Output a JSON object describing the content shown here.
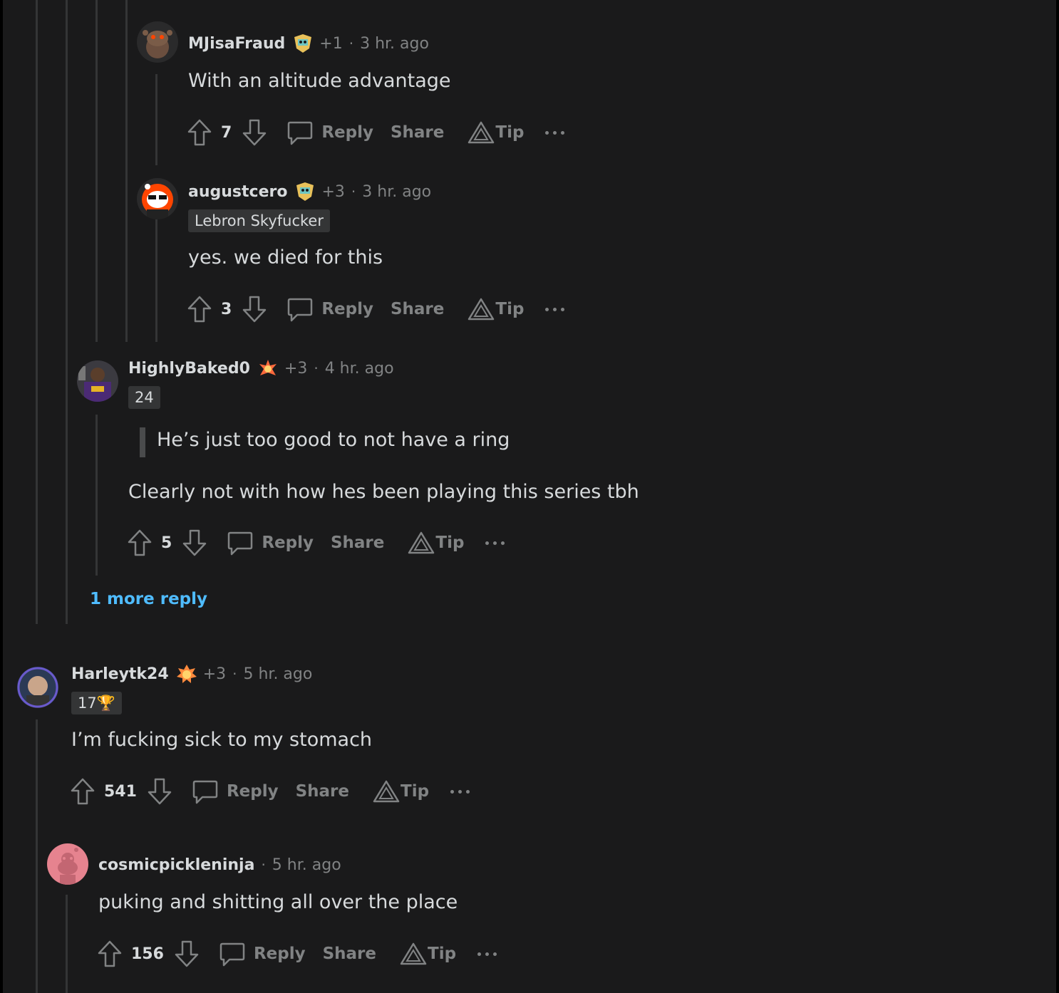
{
  "comments": [
    {
      "username": "MJisaFraud",
      "plus": "+1",
      "time": "3 hr. ago",
      "body": "With an altitude advantage",
      "votes": "7"
    },
    {
      "username": "augustcero",
      "plus": "+3",
      "time": "3 hr. ago",
      "flair": "Lebron Skyfucker",
      "body": "yes. we died for this",
      "votes": "3"
    },
    {
      "username": "HighlyBaked0",
      "plus": "+3",
      "time": "4 hr. ago",
      "flair": "24",
      "quote": "He’s just too good to not have a ring",
      "body": "Clearly not with how hes been playing this series tbh",
      "votes": "5"
    },
    {
      "username": "Harleytk24",
      "plus": "+3",
      "time": "5 hr. ago",
      "flair": "17🏆",
      "body": "I’m fucking sick to my stomach",
      "votes": "541"
    },
    {
      "username": "cosmicpickleninja",
      "time": "5 hr. ago",
      "body": "puking and shitting all over the place",
      "votes": "156"
    }
  ],
  "labels": {
    "reply": "Reply",
    "share": "Share",
    "tip": "Tip",
    "dot": "·",
    "more_replies": "1 more reply"
  },
  "colors": {
    "background": "#1a1a1b",
    "text": "#d7dadc",
    "muted": "#818384",
    "link": "#4fbcff",
    "thread_line": "#343536"
  }
}
